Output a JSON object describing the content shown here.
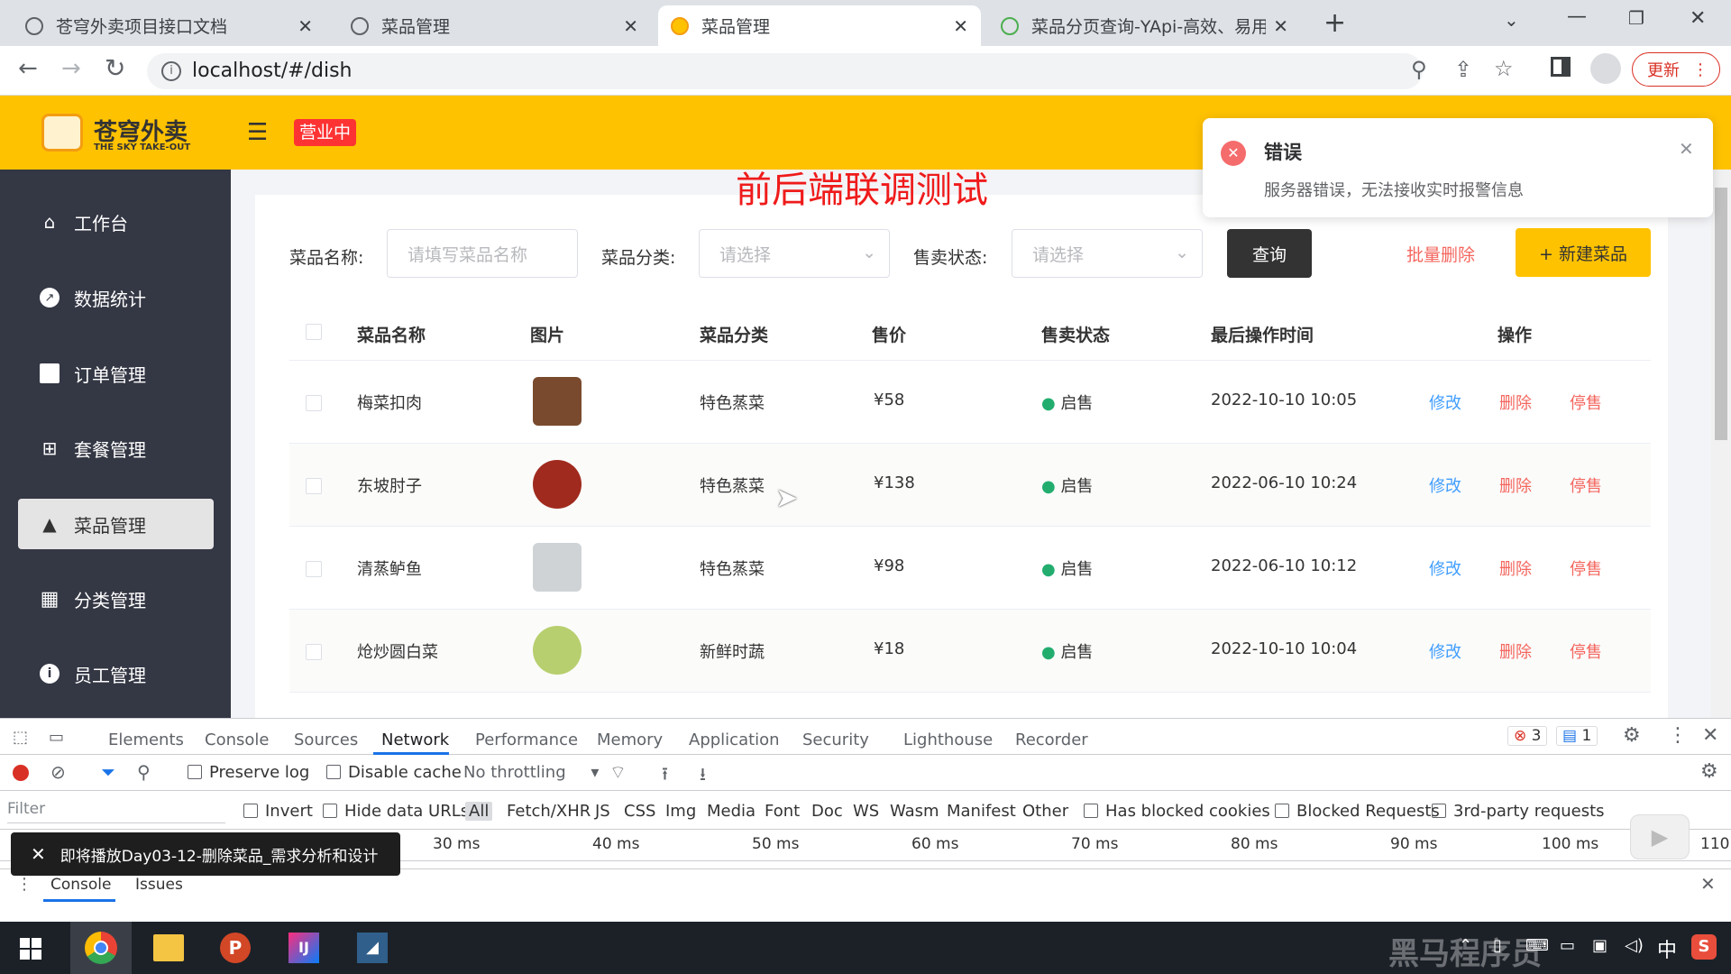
{
  "browser": {
    "tabs": [
      {
        "title": "苍穹外卖项目接口文档",
        "active": false
      },
      {
        "title": "菜品管理",
        "active": false
      },
      {
        "title": "菜品管理",
        "active": true
      },
      {
        "title": "菜品分页查询-YApi-高效、易用...",
        "active": false
      }
    ],
    "new_tab": "+",
    "url": "localhost/#/dish",
    "update_button": "更新"
  },
  "header": {
    "logo_cn": "苍穹外卖",
    "logo_en": "THE SKY TAKE-OUT",
    "status_badge": "营业中"
  },
  "overlay_title": "前后端联调测试",
  "notification": {
    "title": "错误",
    "message": "服务器错误，无法接收实时报警信息"
  },
  "sidebar": {
    "items": [
      {
        "label": "工作台",
        "icon": "home-icon",
        "active": false
      },
      {
        "label": "数据统计",
        "icon": "chart-icon",
        "active": false
      },
      {
        "label": "订单管理",
        "icon": "clipboard-icon",
        "active": false
      },
      {
        "label": "套餐管理",
        "icon": "gift-icon",
        "active": false
      },
      {
        "label": "菜品管理",
        "icon": "dish-icon",
        "active": true
      },
      {
        "label": "分类管理",
        "icon": "grid-icon",
        "active": false
      },
      {
        "label": "员工管理",
        "icon": "info-icon",
        "active": false
      }
    ]
  },
  "filters": {
    "name_label": "菜品名称:",
    "name_placeholder": "请填写菜品名称",
    "category_label": "菜品分类:",
    "category_placeholder": "请选择",
    "status_label": "售卖状态:",
    "status_placeholder": "请选择",
    "query_button": "查询",
    "batch_delete": "批量删除",
    "new_dish": "+ 新建菜品"
  },
  "table": {
    "columns": [
      "菜品名称",
      "图片",
      "菜品分类",
      "售价",
      "售卖状态",
      "最后操作时间",
      "操作"
    ],
    "rows": [
      {
        "name": "梅菜扣肉",
        "category": "特色蒸菜",
        "price": "¥58",
        "status": "启售",
        "time": "2022-10-10 10:05"
      },
      {
        "name": "东坡肘子",
        "category": "特色蒸菜",
        "price": "¥138",
        "status": "启售",
        "time": "2022-06-10 10:24"
      },
      {
        "name": "清蒸鲈鱼",
        "category": "特色蒸菜",
        "price": "¥98",
        "status": "启售",
        "time": "2022-06-10 10:12"
      },
      {
        "name": "炝炒圆白菜",
        "category": "新鲜时蔬",
        "price": "¥18",
        "status": "启售",
        "time": "2022-10-10 10:04"
      }
    ],
    "actions": {
      "edit": "修改",
      "delete": "删除",
      "disable": "停售"
    }
  },
  "devtools": {
    "tabs": [
      "Elements",
      "Console",
      "Sources",
      "Network",
      "Performance",
      "Memory",
      "Application",
      "Security",
      "Lighthouse",
      "Recorder"
    ],
    "active_tab": "Network",
    "error_count": "3",
    "message_count": "1",
    "preserve_log": "Preserve log",
    "disable_cache": "Disable cache",
    "throttling": "No throttling",
    "filter_placeholder": "Filter",
    "invert": "Invert",
    "hide_data_urls": "Hide data URLs",
    "types": [
      "All",
      "Fetch/XHR",
      "JS",
      "CSS",
      "Img",
      "Media",
      "Font",
      "Doc",
      "WS",
      "Wasm",
      "Manifest",
      "Other"
    ],
    "has_blocked_cookies": "Has blocked cookies",
    "blocked_requests": "Blocked Requests",
    "third_party": "3rd-party requests",
    "timeline": [
      "30 ms",
      "40 ms",
      "50 ms",
      "60 ms",
      "70 ms",
      "80 ms",
      "90 ms",
      "100 ms",
      "110"
    ],
    "drawer_tabs": [
      "Console",
      "Issues"
    ],
    "toast": "即将播放Day03-12-删除菜品_需求分析和设计"
  },
  "taskbar": {
    "ime": "中",
    "watermark": "黑马程序员"
  },
  "colors": {
    "brand_yellow": "#ffc200",
    "sidebar_bg": "#343744",
    "link_blue": "#419eff",
    "danger_red": "#f4665e",
    "status_green": "#22ad6e"
  }
}
